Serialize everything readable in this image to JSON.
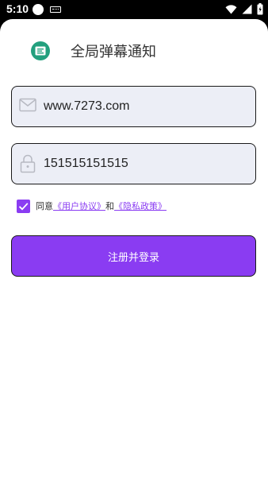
{
  "status_bar": {
    "time": "5:10"
  },
  "header": {
    "app_icon": "notification-card-icon",
    "title": "全局弹幕通知"
  },
  "form": {
    "email_field": {
      "icon": "mail-icon",
      "value": "www.7273.com"
    },
    "password_field": {
      "icon": "lock-icon",
      "value": "151515151515"
    },
    "agreement": {
      "checked": true,
      "prefix": "同意",
      "user_agreement_link": "《用户协议》",
      "conjunction": "和",
      "privacy_policy_link": "《隐私政策》"
    },
    "submit_label": "注册并登录"
  },
  "colors": {
    "accent": "#8a3cf2",
    "app_icon": "#23a07e",
    "field_bg": "#eceef6"
  }
}
